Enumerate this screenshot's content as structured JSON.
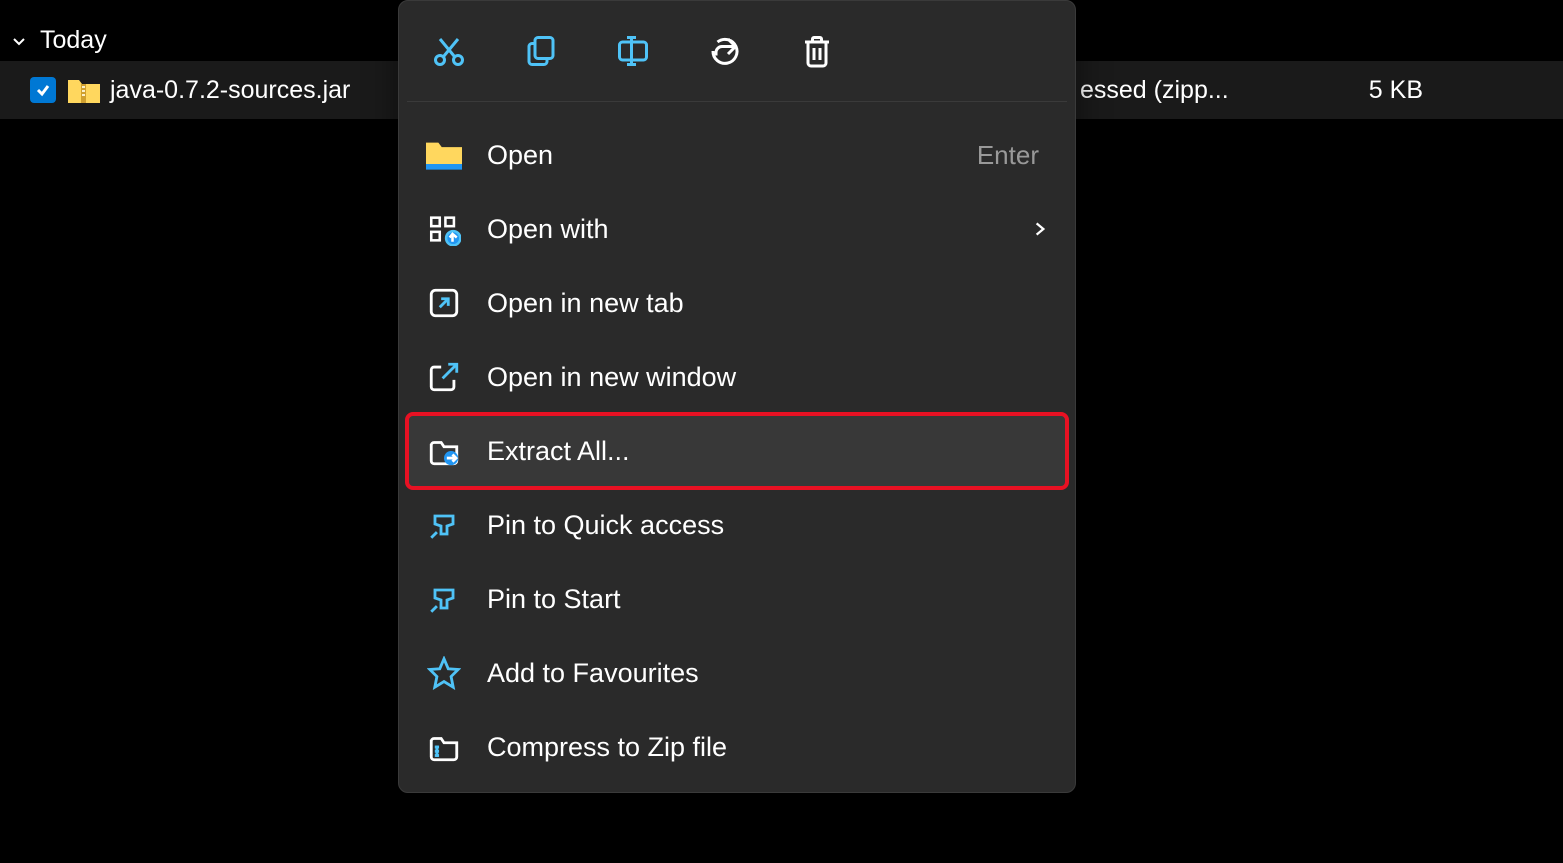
{
  "group": {
    "label": "Today"
  },
  "file": {
    "name": "java-0.7.2-sources.jar",
    "type": "essed (zipp...",
    "size": "5 KB"
  },
  "contextMenu": {
    "items": [
      {
        "label": "Open",
        "shortcut": "Enter"
      },
      {
        "label": "Open with"
      },
      {
        "label": "Open in new tab"
      },
      {
        "label": "Open in new window"
      },
      {
        "label": "Extract All..."
      },
      {
        "label": "Pin to Quick access"
      },
      {
        "label": "Pin to Start"
      },
      {
        "label": "Add to Favourites"
      },
      {
        "label": "Compress to Zip file"
      }
    ]
  }
}
